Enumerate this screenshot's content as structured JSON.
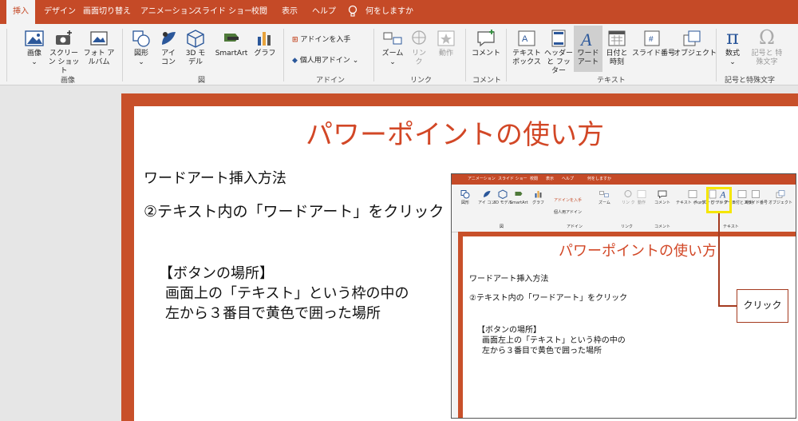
{
  "tabs": [
    "挿入",
    "デザイン",
    "画面切り替え",
    "アニメーション",
    "スライド ショー",
    "校閲",
    "表示",
    "ヘルプ"
  ],
  "tell_me": "何をしますか",
  "ribbon": {
    "images": {
      "label": "画像",
      "btn_image": "画像",
      "btn_screenshot": "スクリーン ショット",
      "btn_photo": "フォト アルバム"
    },
    "illustrations": {
      "label": "図",
      "shapes": "図形",
      "icons": "アイ コン",
      "model3d": "3D モデル",
      "smartart": "SmartArt",
      "chart": "グラフ"
    },
    "addins": {
      "label": "アドイン",
      "get": "アドインを入手",
      "personal": "個人用アドイン"
    },
    "links": {
      "label": "リンク",
      "zoom": "ズーム",
      "link": "リン ク",
      "action": "動作"
    },
    "comments": {
      "label": "コメント",
      "comment": "コメント"
    },
    "text": {
      "label": "テキスト",
      "textbox": "テキスト ボックス",
      "header": "ヘッダーと フッター",
      "wordart": "ワード アート",
      "datetime": "日付と 時刻",
      "slidenum": "スライド番号",
      "object": "オブジェクト"
    },
    "symbols": {
      "label": "記号と特殊文字",
      "equation": "数式",
      "symbol": "記号と 特殊文字"
    }
  },
  "slide": {
    "title": "パワーポイントの使い方",
    "line1": "ワードアート挿入方法",
    "line2": "②テキスト内の「ワードアート」をクリック",
    "box_title": "【ボタンの場所】",
    "box_line1": "画面上の「テキスト」という枠の中の",
    "box_line2": "左から３番目で黄色で囲った場所"
  },
  "inset": {
    "tabs": [
      "アニメーション",
      "スライド ショー",
      "校閲",
      "表示",
      "ヘルプ",
      "何をしますか"
    ],
    "title": "パワーポイントの使い方",
    "line1": "ワードアート挿入方法",
    "line2": "②テキスト内の「ワードアート」をクリック",
    "box_title": "【ボタンの場所】",
    "box_line1": "画面左上の「テキスト」という枠の中の",
    "box_line2": "左から３番目で黄色で囲った場所",
    "callout": "クリック"
  },
  "colors": {
    "accent": "#c54a27",
    "title": "#d24726",
    "highlight": "#f5e600"
  }
}
